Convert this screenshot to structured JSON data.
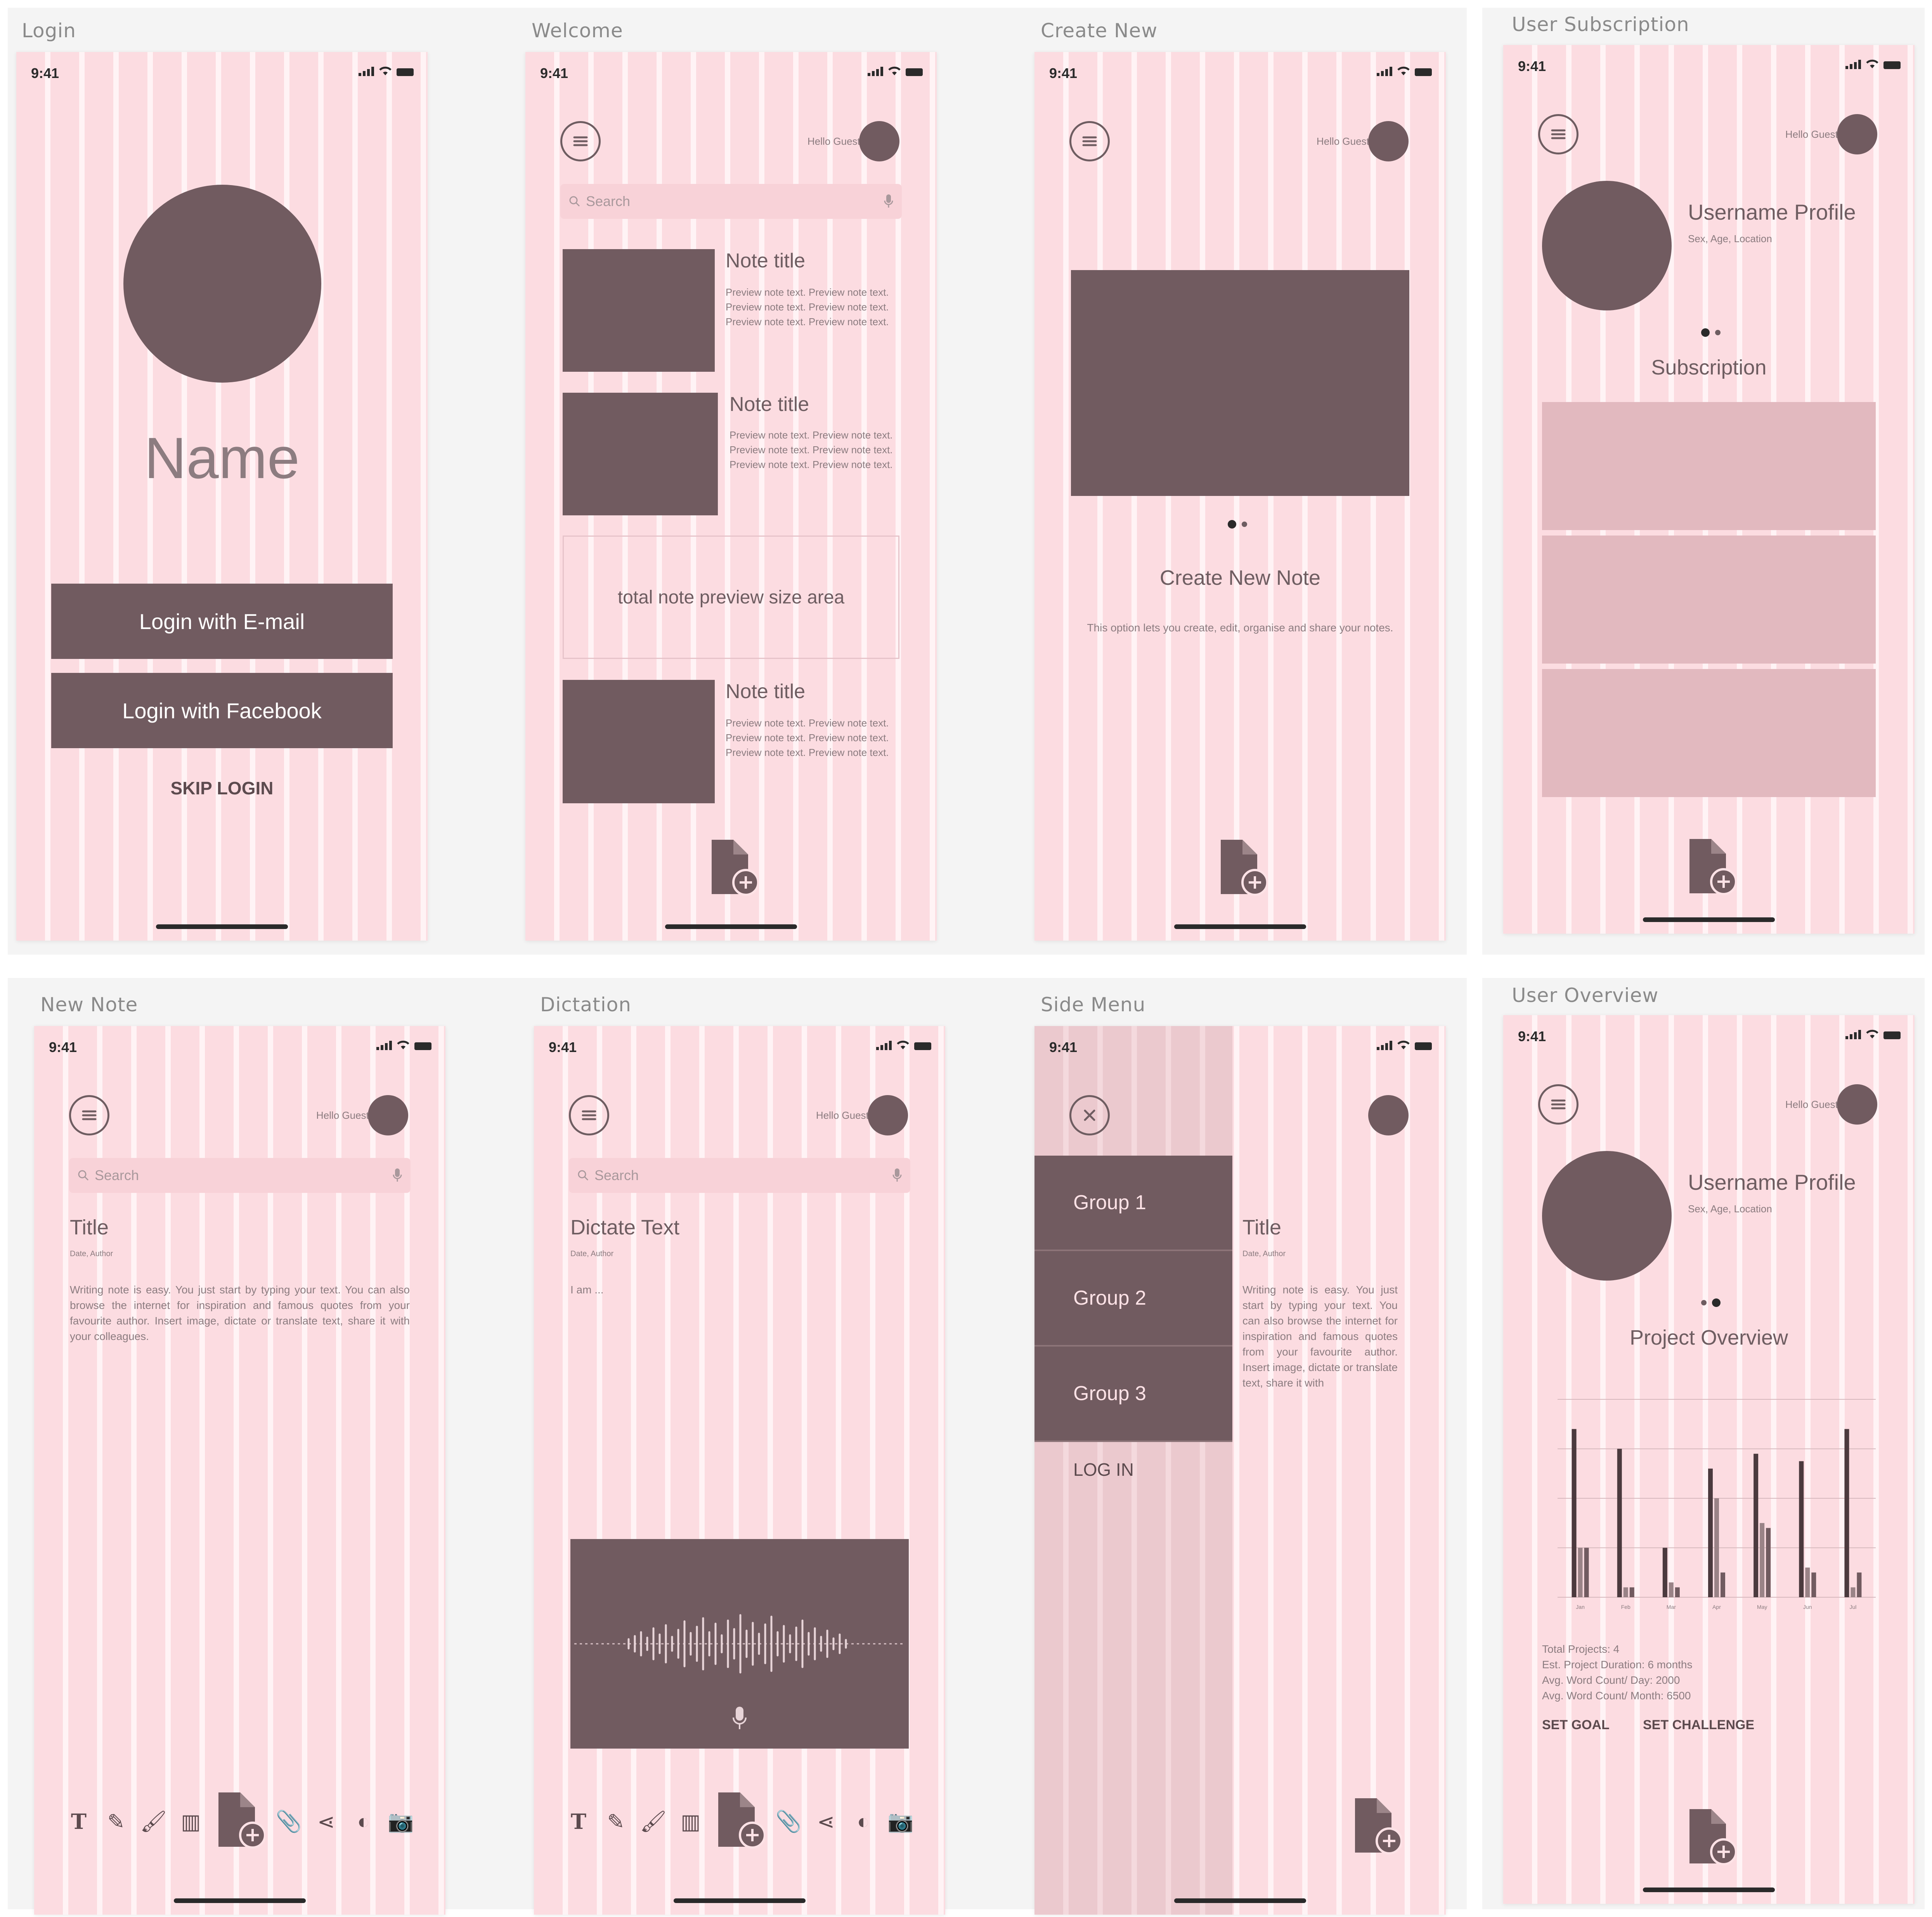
{
  "status_time": "9:41",
  "hello_text": "Hello Guest!",
  "search_placeholder": "Search",
  "screens": {
    "login": {
      "label": "Login",
      "name": "Name",
      "email_btn": "Login with E-mail",
      "fb_btn": "Login with Facebook",
      "skip": "SKIP LOGIN"
    },
    "welcome": {
      "label": "Welcome",
      "notes": [
        {
          "title": "Note title",
          "preview": "Preview note text. Preview note text. Preview note text. Preview note text. Preview note text. Preview note text."
        },
        {
          "title": "Note title",
          "preview": "Preview note text. Preview note text. Preview note text. Preview note text. Preview note text. Preview note text."
        },
        {
          "title": "Note title",
          "preview": "Preview note text. Preview note text. Preview note text. Preview note text. Preview note text. Preview note text."
        }
      ],
      "preview_area": "total note preview size area"
    },
    "create_new": {
      "label": "Create New",
      "title": "Create New Note",
      "desc": "This option lets you create, edit, organise and share your notes."
    },
    "user_subscription": {
      "label": "User Subscription",
      "profile": "Username Profile",
      "meta": "Sex, Age, Location",
      "section": "Subscription"
    },
    "new_note": {
      "label": "New Note",
      "title": "Title",
      "meta": "Date, Author",
      "body": "Writing note is easy. You just start by typing your text. You can also browse the internet for inspiration and famous quotes from your favourite author. Insert image, dictate or translate text, share it with your colleagues."
    },
    "dictation": {
      "label": "Dictation",
      "title": "Dictate Text",
      "meta": "Date, Author",
      "body": "I am ..."
    },
    "side_menu": {
      "label": "Side Menu",
      "groups": [
        "Group 1",
        "Group 2",
        "Group 3"
      ],
      "login": "LOG IN",
      "title": "Title",
      "meta": "Date, Author",
      "body": "Writing note is easy. You just start by typing your text. You can also browse the internet for inspiration and famous quotes from your favourite author. Insert image, dictate or translate text, share it with"
    },
    "user_overview": {
      "label": "User Overview",
      "profile": "Username Profile",
      "meta": "Sex, Age, Location",
      "section": "Project Overview",
      "stats": [
        "Total Projects: 4",
        "Est. Project Duration: 6 months",
        "Avg. Word Count/ Day: 2000",
        "Avg. Word Count/ Month: 6500"
      ],
      "goal_btn": "SET GOAL",
      "challenge_btn": "SET CHALLENGE"
    }
  },
  "toolbar_icons": [
    "text-icon",
    "pen-icon",
    "brush-icon",
    "library-icon",
    "attach-icon",
    "share-icon",
    "translate-icon",
    "camera-icon"
  ],
  "colors": {
    "screen_bg": "#fde2e6",
    "dark": "#715b60",
    "accent_light": "#e2b9bf"
  },
  "chart_data": {
    "type": "bar",
    "categories": [
      "Jan",
      "Feb",
      "Mar",
      "Apr",
      "May",
      "Jun",
      "Jul"
    ],
    "series": [
      {
        "values": [
          68,
          60,
          20,
          52,
          58,
          55,
          68
        ]
      },
      {
        "values": [
          20,
          4,
          6,
          40,
          30,
          12,
          4
        ]
      },
      {
        "values": [
          20,
          4,
          4,
          10,
          28,
          10,
          10
        ]
      }
    ],
    "ylim": [
      0,
      80
    ]
  }
}
